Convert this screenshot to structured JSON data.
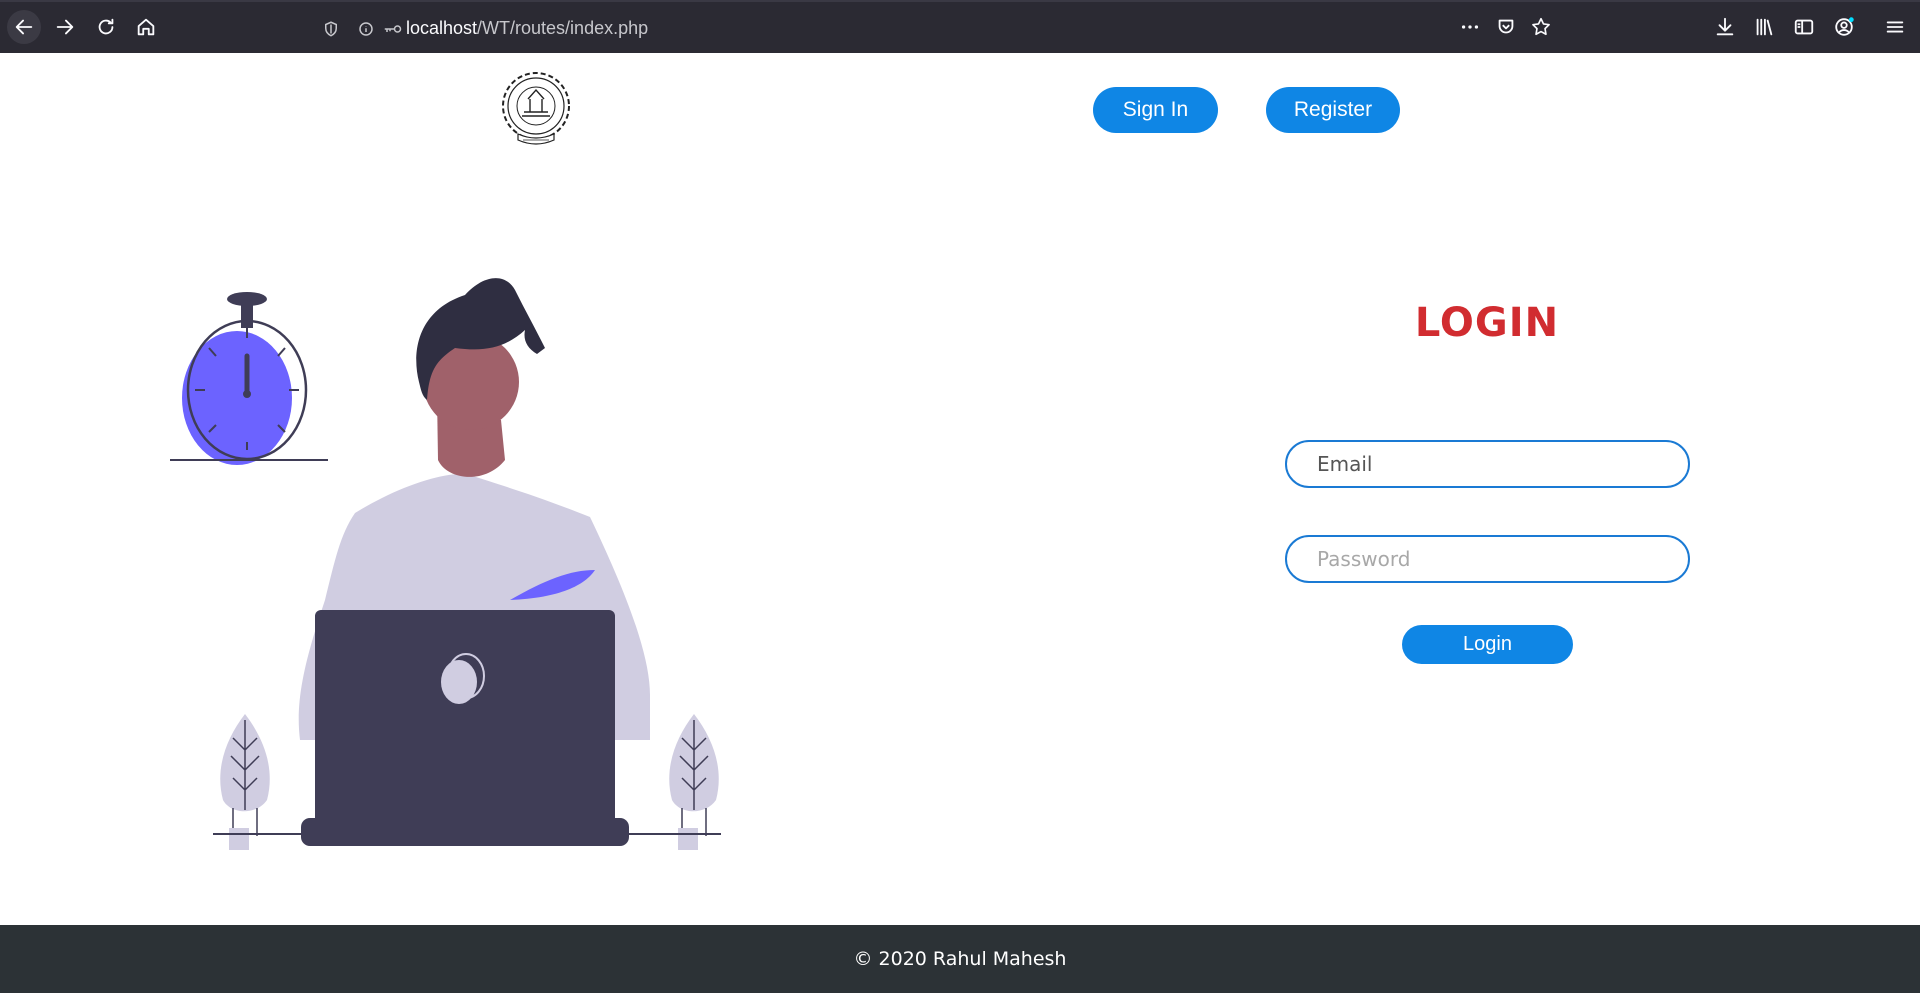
{
  "browser": {
    "url_host": "localhost",
    "url_path": "/WT/routes/index.php",
    "icons": [
      "back-icon",
      "forward-icon",
      "reload-icon",
      "home-icon",
      "shield-icon",
      "info-icon",
      "key-icon",
      "more-icon",
      "pocket-icon",
      "star-icon",
      "download-icon",
      "library-icon",
      "sidebar-icon",
      "account-icon",
      "menu-icon"
    ]
  },
  "header": {
    "signin_label": "Sign In",
    "register_label": "Register"
  },
  "login": {
    "title": "LOGIN",
    "email_placeholder": "Email",
    "password_placeholder": "Password",
    "button_label": "Login"
  },
  "footer": {
    "text": "© 2020 Rahul Mahesh"
  },
  "colors": {
    "accent": "#0f86e5",
    "title": "#d12c30",
    "footer_bg": "#2c3236",
    "toolbar_bg": "#2b2a33",
    "illustration_purple": "#6c63ff",
    "illustration_dark": "#3f3d56"
  }
}
